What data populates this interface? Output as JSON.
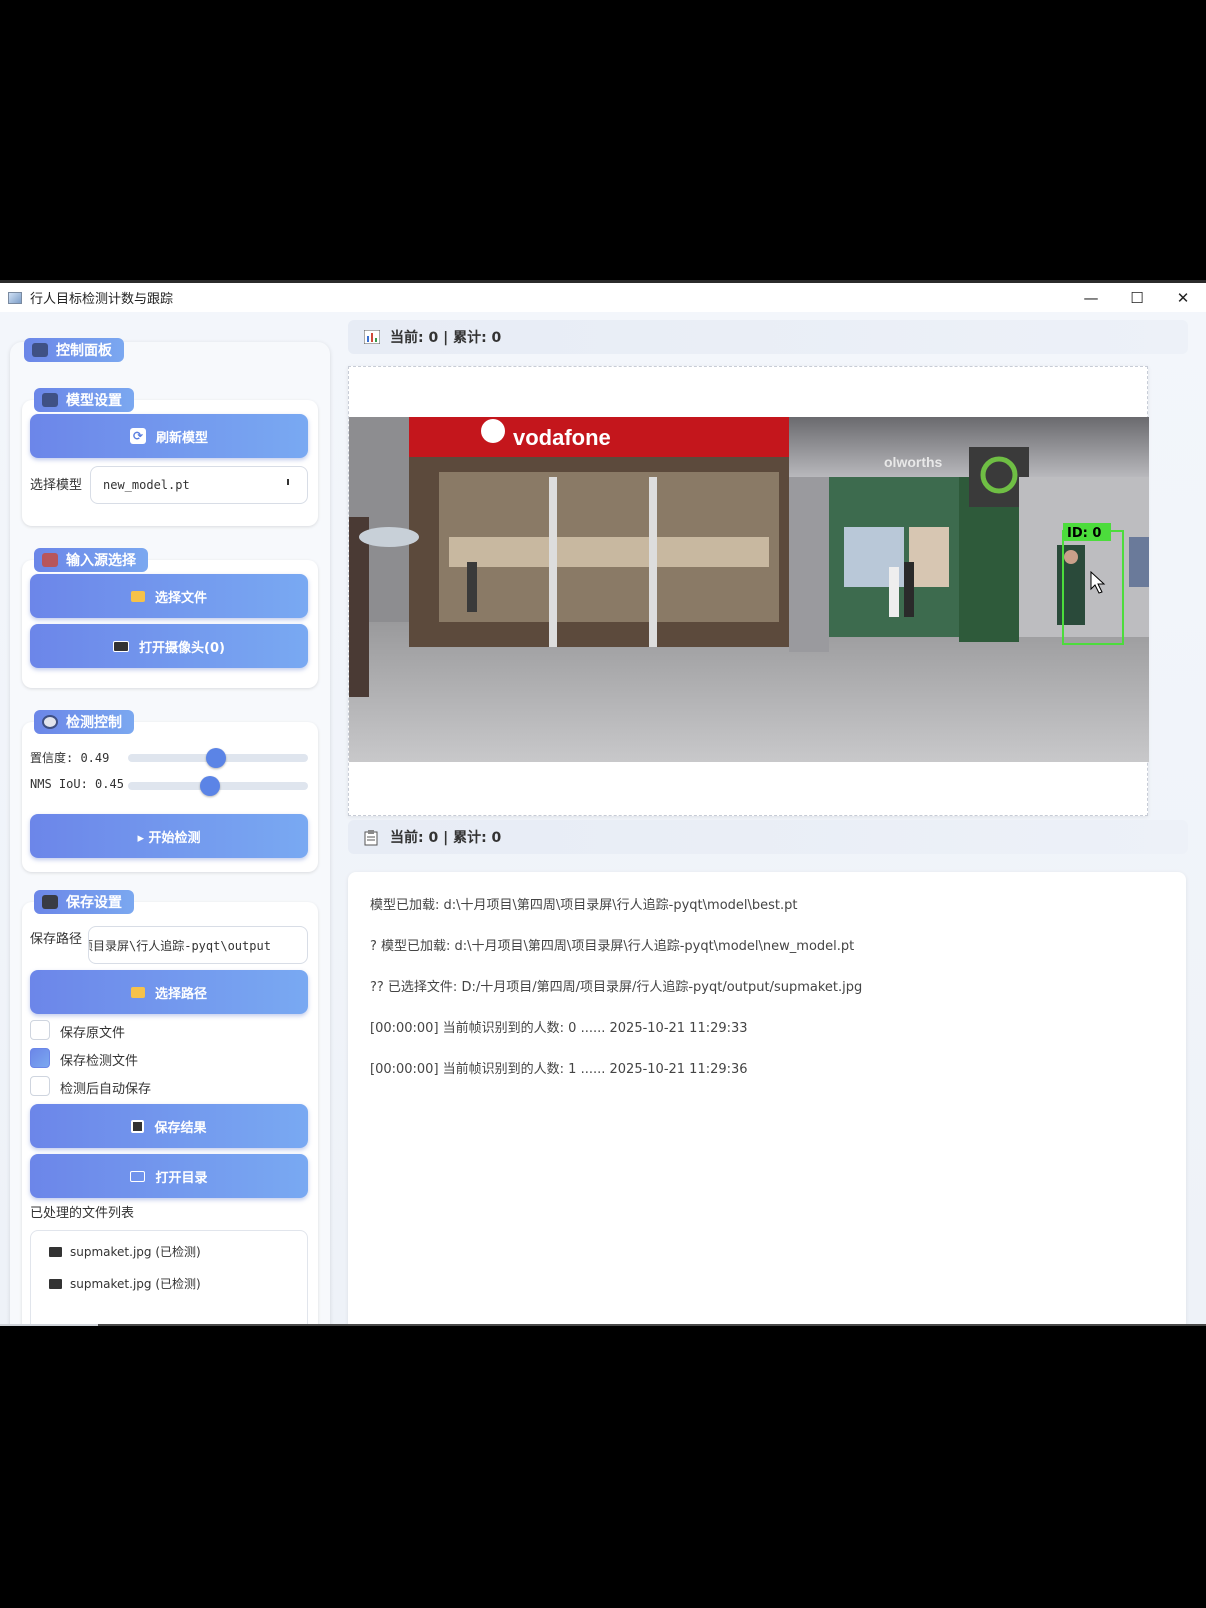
{
  "window": {
    "title": "行人目标检测计数与跟踪",
    "controls": {
      "minimize": "—",
      "maximize": "☐",
      "close": "✕"
    }
  },
  "control_panel": {
    "title": "控制面板",
    "model_settings": {
      "title": "模型设置",
      "refresh_button": "刷新模型",
      "select_label": "选择模型",
      "selected_model": "new_model.pt"
    },
    "input_source": {
      "title": "输入源选择",
      "select_file_button": "选择文件",
      "open_camera_button": "打开摄像头(0)"
    },
    "detection_control": {
      "title": "检测控制",
      "confidence_label": "置信度: 0.49",
      "confidence_value": 0.49,
      "iou_label": "NMS IoU: 0.45",
      "iou_value": 0.45,
      "start_button": "▸ 开始检测"
    },
    "save_settings": {
      "title": "保存设置",
      "path_label": "保存路径",
      "path_value": "项目录屏\\行人追踪-pyqt\\output",
      "select_path_button": "选择路径",
      "checkboxes": [
        {
          "label": "保存原文件",
          "checked": false
        },
        {
          "label": "保存检测文件",
          "checked": true
        },
        {
          "label": "检测后自动保存",
          "checked": false
        }
      ],
      "save_results_button": "保存结果",
      "open_dir_button": "打开目录"
    },
    "processed_files": {
      "title": "已处理的文件列表",
      "items": [
        "supmaket.jpg (已检测)",
        "supmaket.jpg (已检测)"
      ]
    }
  },
  "top_stats": {
    "text": "当前: 0 | 累计: 0"
  },
  "log_stats": {
    "text": "当前: 0 | 累计: 0"
  },
  "scene": {
    "store_sign": "vodafone",
    "store_sign2": "olworths",
    "detection_label": "ID: 0"
  },
  "log": [
    "模型已加载: d:\\十月项目\\第四周\\项目录屏\\行人追踪-pyqt\\model\\best.pt",
    "? 模型已加载: d:\\十月项目\\第四周\\项目录屏\\行人追踪-pyqt\\model\\new_model.pt",
    "?? 已选择文件: D:/十月项目/第四周/项目录屏/行人追踪-pyqt/output/supmaket.jpg",
    "[00:00:00] 当前帧识别到的人数: 0 ...... 2025-10-21 11:29:33",
    "[00:00:00] 当前帧识别到的人数: 1 ...... 2025-10-21 11:29:36"
  ],
  "colors": {
    "accent": "#6b86e8",
    "accent2": "#7ba8f0",
    "bbox": "#4cdc3c"
  }
}
